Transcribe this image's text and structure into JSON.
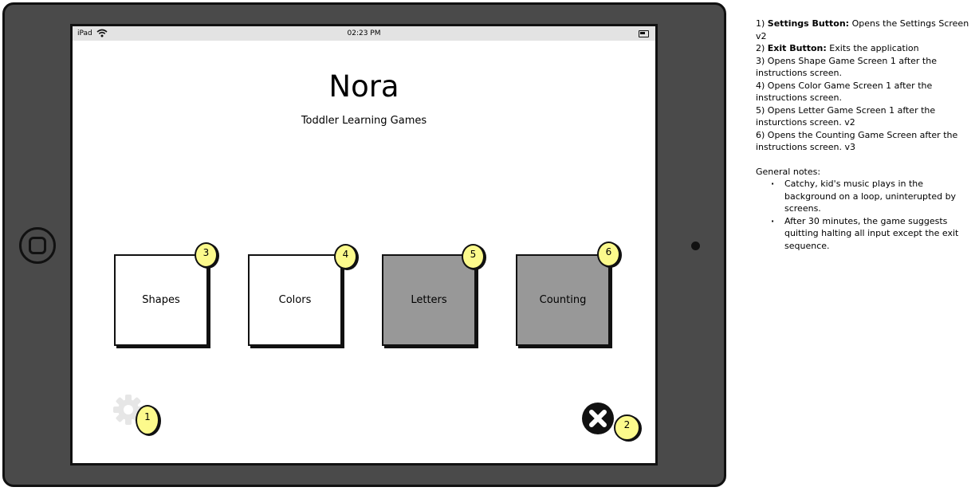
{
  "statusbar": {
    "carrier": "iPad",
    "time": "02:23 PM"
  },
  "app": {
    "title": "Nora",
    "subtitle": "Toddler Learning Games"
  },
  "tiles": [
    {
      "label": "Shapes",
      "marker": "3"
    },
    {
      "label": "Colors",
      "marker": "4"
    },
    {
      "label": "Letters",
      "marker": "5"
    },
    {
      "label": "Counting",
      "marker": "6"
    }
  ],
  "settings": {
    "marker": "1"
  },
  "exit": {
    "marker": "2"
  },
  "colors": {
    "tile_white": "#ffffff",
    "tile_gray": "#989898",
    "marker_yellow": "#fcfa8c",
    "device": "#4a4a4a"
  },
  "notes": {
    "items": [
      {
        "num": "1)",
        "bold": "Settings Button:",
        "text": "Opens the Settings Screen v2"
      },
      {
        "num": "2)",
        "bold": "Exit Button:",
        "text": "Exits the application"
      },
      {
        "num": "3)",
        "bold": "",
        "text": "Opens Shape Game Screen 1 after the instructions screen."
      },
      {
        "num": "4)",
        "bold": "",
        "text": "Opens Color Game Screen 1 after the instructions screen."
      },
      {
        "num": "5)",
        "bold": "",
        "text": "Opens Letter Game Screen 1 after the insturctions screen. v2"
      },
      {
        "num": "6)",
        "bold": "",
        "text": "Opens the Counting Game Screen after the instructions screen. v3"
      }
    ],
    "general_title": "General notes:",
    "bullets": [
      "Catchy, kid's music plays in the background on a loop, uninterupted by screens.",
      "After 30 minutes, the game suggests quitting halting all input except the exit sequence."
    ]
  }
}
